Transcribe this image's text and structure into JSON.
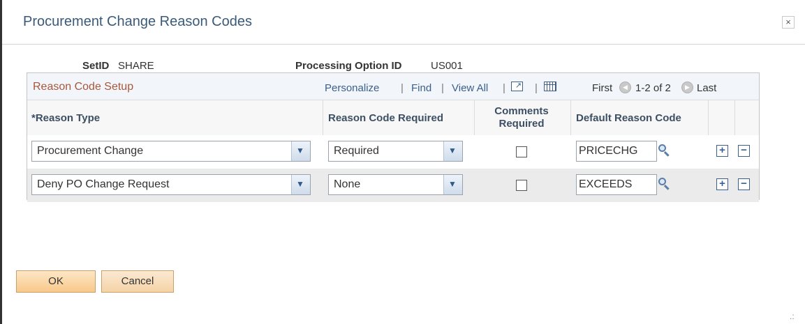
{
  "window": {
    "title": "Procurement Change Reason Codes",
    "close_symbol": "×"
  },
  "header": {
    "setid_label": "SetID",
    "setid_value": "SHARE",
    "option_label": "Processing Option ID",
    "option_value": "US001"
  },
  "grid": {
    "title": "Reason Code Setup",
    "nav": {
      "personalize": "Personalize",
      "find": "Find",
      "view_all": "View All",
      "sep": "|",
      "first": "First",
      "range": "1-2 of 2",
      "last": "Last"
    },
    "columns": {
      "reason_type": "*Reason Type",
      "code_required": "Reason Code Required",
      "comments_required": "Comments Required",
      "default_code": "Default Reason Code"
    },
    "rows": [
      {
        "reason_type": "Procurement Change",
        "code_required": "Required",
        "comments_required": false,
        "default_code": "PRICECHG"
      },
      {
        "reason_type": "Deny PO Change Request",
        "code_required": "None",
        "comments_required": false,
        "default_code": "EXCEEDS"
      }
    ]
  },
  "buttons": {
    "ok": "OK",
    "cancel": "Cancel"
  },
  "icons": {
    "dropdown": "chevron-down-icon",
    "lookup": "magnifier-icon",
    "add": "plus-icon",
    "delete": "minus-icon",
    "zoom": "new-window-icon",
    "download": "spreadsheet-icon"
  },
  "colors": {
    "title": "#3a5a7a",
    "grid_title": "#a8573b",
    "link": "#3a5f8c",
    "button_bg": "#f8c98a"
  }
}
